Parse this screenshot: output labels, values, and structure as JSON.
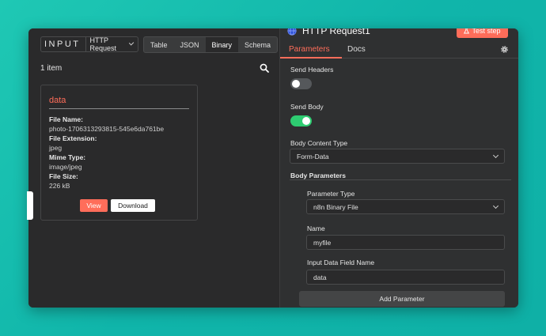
{
  "input_panel": {
    "label": "INPUT",
    "node_selector": "HTTP Request",
    "view_tabs": [
      "Table",
      "JSON",
      "Binary",
      "Schema"
    ],
    "active_view": "Binary",
    "item_count": "1 item",
    "binary_card": {
      "title": "data",
      "fields": [
        {
          "key": "File Name:",
          "value": "photo-1706313293815-545e6da761be"
        },
        {
          "key": "File Extension:",
          "value": "jpeg"
        },
        {
          "key": "Mime Type:",
          "value": "image/jpeg"
        },
        {
          "key": "File Size:",
          "value": "226 kB"
        }
      ],
      "view_label": "View",
      "download_label": "Download"
    }
  },
  "node_panel": {
    "title": "HTTP Request1",
    "test_step_label": "Test step",
    "tabs": [
      "Parameters",
      "Docs"
    ],
    "active_tab": "Parameters",
    "send_headers": {
      "label": "Send Headers",
      "enabled": false
    },
    "send_body": {
      "label": "Send Body",
      "enabled": true
    },
    "body_content_type": {
      "label": "Body Content Type",
      "value": "Form-Data"
    },
    "body_parameters": {
      "label": "Body Parameters",
      "parameter_type": {
        "label": "Parameter Type",
        "value": "n8n Binary File"
      },
      "name": {
        "label": "Name",
        "value": "myfile"
      },
      "input_data_field_name": {
        "label": "Input Data Field Name",
        "value": "data"
      }
    },
    "add_parameter_label": "Add Parameter"
  },
  "colors": {
    "accent": "#ff6d5a",
    "toggle_on": "#2ecc71",
    "toggle_off": "#55585b",
    "background": "#13bfae"
  }
}
